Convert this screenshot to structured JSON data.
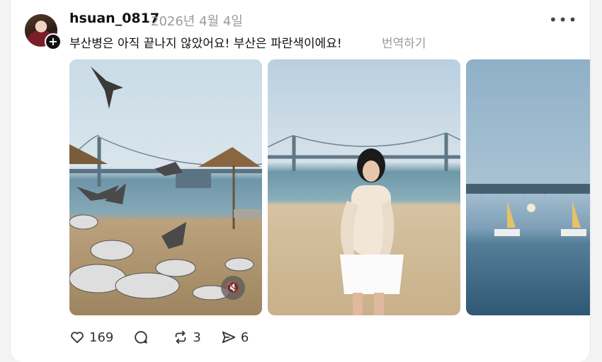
{
  "post": {
    "username": "hsuan_0817",
    "date": "2026년 4월 4일",
    "text": "부산병은 아직 끝나지 않았어요! 부산은 파란색이에요!",
    "translate_label": "번역하기",
    "more_label": "•••",
    "avatar_plus": "+"
  },
  "media": {
    "mute_icon": "🔇"
  },
  "actions": {
    "likes": "169",
    "replies": "",
    "reposts": "3",
    "shares": "6"
  }
}
